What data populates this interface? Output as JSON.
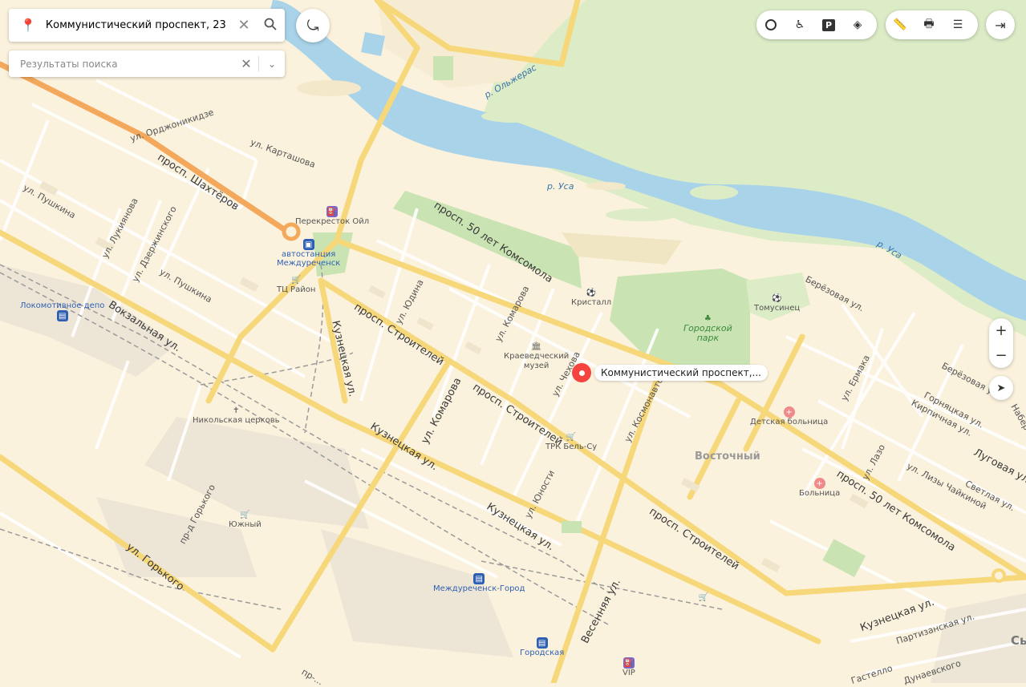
{
  "search": {
    "query": "Коммунистический проспект, 23",
    "results_placeholder": "Результаты поиска"
  },
  "marker": {
    "label": "Коммунистический проспект,..."
  },
  "toolbar": {
    "icons": [
      "traffic-icon",
      "panorama-icon",
      "parking-icon",
      "layers-icon",
      "ruler-icon",
      "print-icon",
      "menu-icon",
      "login-icon"
    ]
  },
  "zoom": {
    "plus": "+",
    "minus": "−"
  },
  "streets": {
    "shakhtyorov": "просп. Шахтёров",
    "komsomola1": "просп. 50 лет Комсомола",
    "komsomola2": "просп. 50 лет Комсомола",
    "stroiteley1": "просп. Строителей",
    "stroiteley2": "просп. Строителей",
    "stroiteley3": "просп. Строителей",
    "kuznetskaya1": "Кузнецкая ул.",
    "kuznetskaya2": "Кузнецкая ул.",
    "kuznetskaya3": "Кузнецкая ул.",
    "kuznetskaya4": "Кузнецкая ул.",
    "komarova1": "ул. Комарова",
    "komarova2": "ул. Комарова",
    "vokzalnaya": "Вокзальная ул.",
    "gorkogo": "ул. Горького",
    "pr_gorkogo": "пр-д Горького",
    "pushkina1": "ул. Пушкина",
    "pushkina2": "ул. Пушкина",
    "lukiyanova": "ул. Лукиянова",
    "dzerzhinskogo": "ул. Дзержинского",
    "ordzhonikidze": "ул. Орджоникидзе",
    "kartashova": "ул. Карташова",
    "yudina": "ул. Юдина",
    "chekhova": "ул. Чехова",
    "yunosti": "ул. Юности",
    "kosmonavtov": "ул. Космонавто...",
    "vesennyaya": "Весенняя ул.",
    "olzheras": "р. Ольжерас",
    "berezovaya1": "Берёзовая ул.",
    "berezovaya2": "Берёзовая ул.",
    "ermaka": "ул. Ермака",
    "gornyatskaya": "Горняцкая ул.",
    "kirpichnaya": "Кирпичная ул.",
    "lugovaya": "Луговая ул.",
    "lazo": "ул. Лазо",
    "lizy": "ул. Лизы Чайкиной",
    "svetlaya": "Светлая ул.",
    "partizanskaya": "Партизанская ул.",
    "kastello": "Гастелло",
    "dunaevskogo": "Дунаевского",
    "naberezhnaya": "Набережная",
    "pr": "пр-..."
  },
  "rivers": {
    "usa1": "р. Уса",
    "usa2": "р. Уса"
  },
  "places": {
    "perekrestok": "Перекресток Ойл",
    "avtostanciya": "автостанция\nМеждуреченск",
    "tc_rayon": "ТЦ Район",
    "lokomotiv": "Локомотивное депо",
    "nikolskaya": "Никольская церковь",
    "yuzhny": "Южный",
    "kristall": "Кристалл",
    "kraeved": "Краеведческий\nмузей",
    "trk": "ТРК Бель-Су",
    "gorpark": "Городской\nпарк",
    "tomusinets": "Томусинец",
    "det_boln": "Детская больница",
    "bolnica": "Больница",
    "vostochny": "Восточный",
    "mezh_gorod": "Междуреченск-Город",
    "gorodskaya": "Городская",
    "vip": "VIP",
    "sy": "Сы"
  },
  "colors": {
    "land": "#fbf2dd",
    "water": "#a9d3e8",
    "forest": "#dcecc6",
    "park": "#c9e3b2",
    "major_road": "#f6d77a",
    "highway": "#f3a85c",
    "marker": "#f5433f",
    "transport": "#2f5fb3"
  }
}
